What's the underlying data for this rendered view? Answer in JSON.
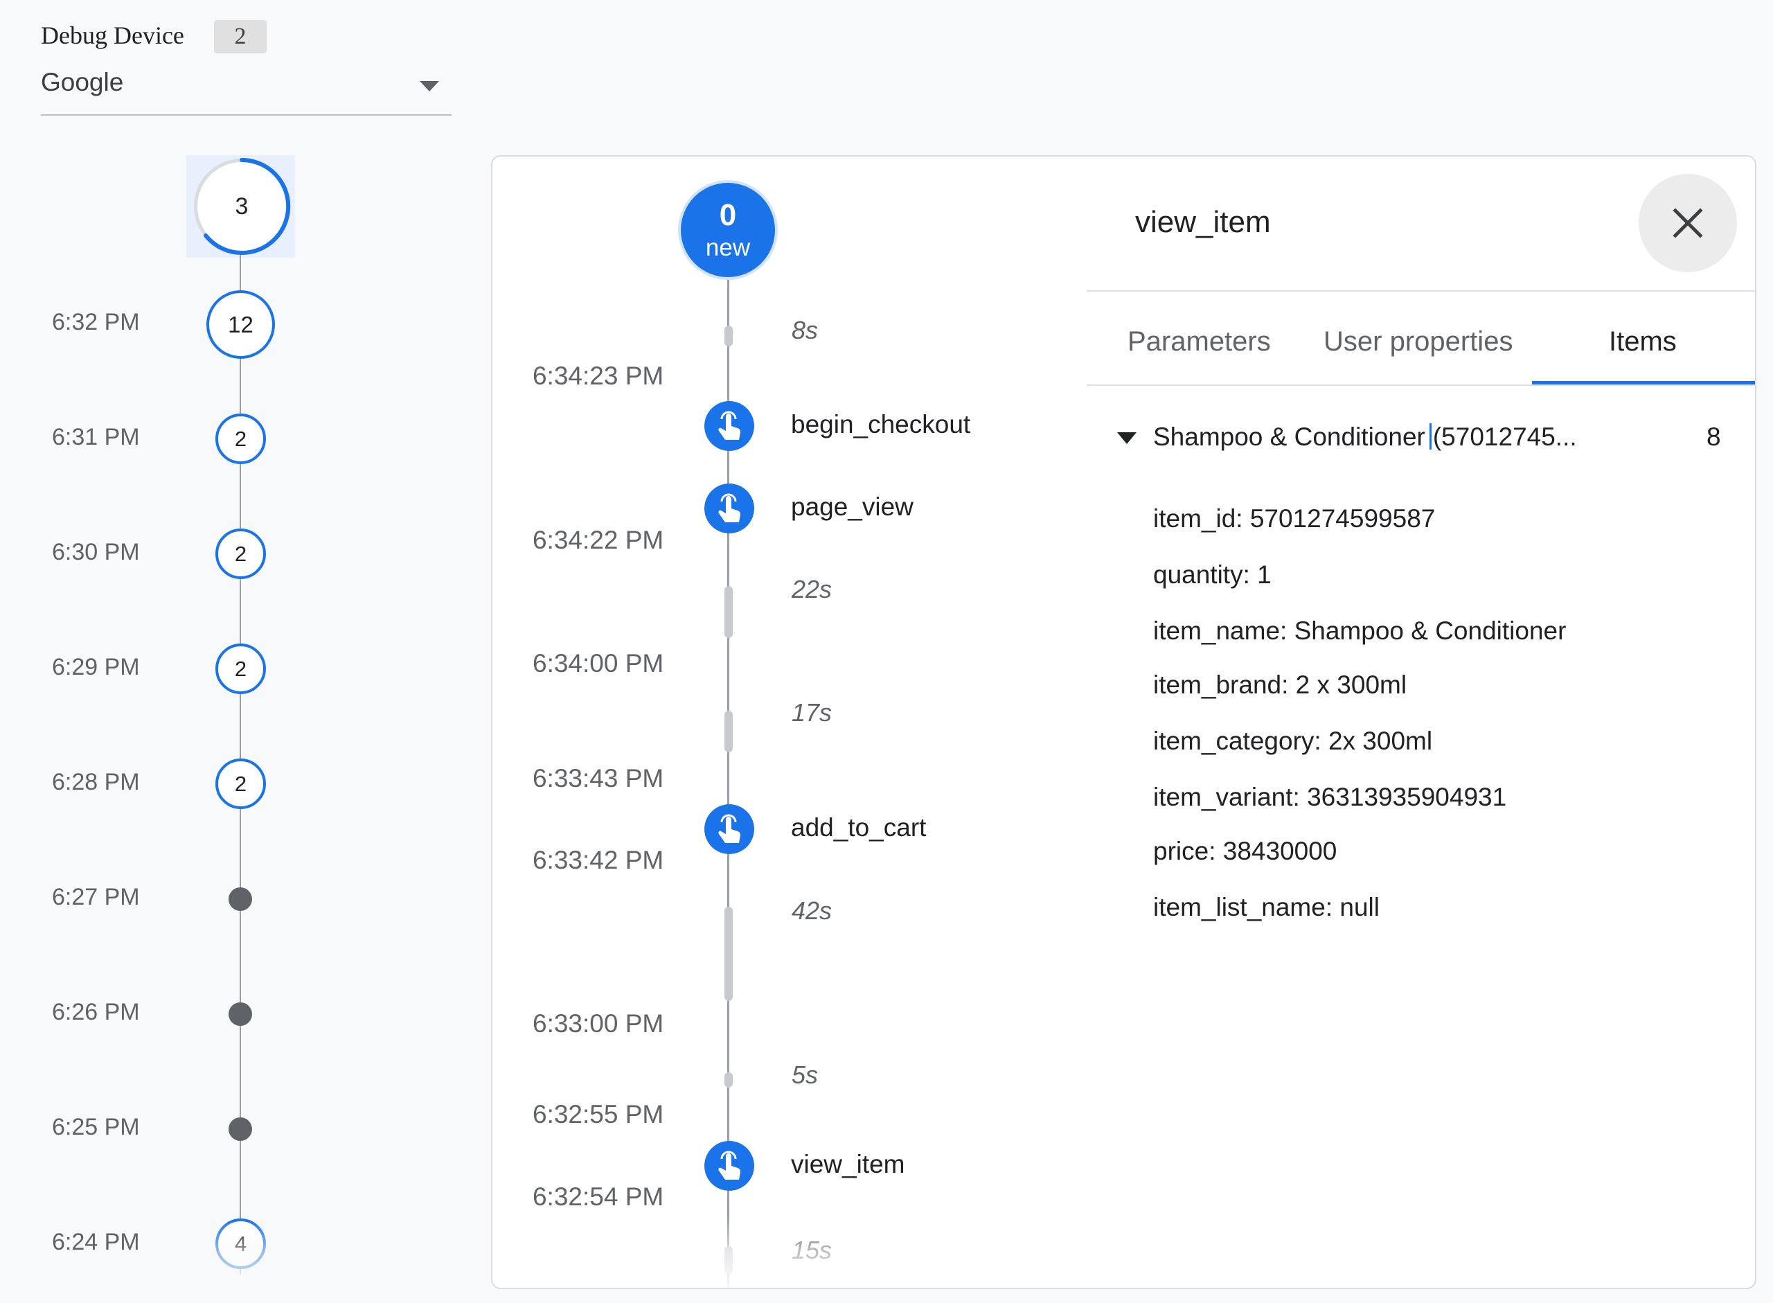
{
  "debug_device": {
    "label": "Debug Device",
    "count": "2",
    "selected": "Google"
  },
  "minutes": {
    "current_count": "3",
    "rows": [
      {
        "time": "6:32 PM",
        "count": "12"
      },
      {
        "time": "6:31 PM",
        "count": "2"
      },
      {
        "time": "6:30 PM",
        "count": "2"
      },
      {
        "time": "6:29 PM",
        "count": "2"
      },
      {
        "time": "6:28 PM",
        "count": "2"
      },
      {
        "time": "6:27 PM",
        "count": null
      },
      {
        "time": "6:26 PM",
        "count": null
      },
      {
        "time": "6:25 PM",
        "count": null
      },
      {
        "time": "6:24 PM",
        "count": "4"
      }
    ]
  },
  "events": {
    "new_count": "0",
    "new_label": "new",
    "gaps": [
      "8s",
      "22s",
      "17s",
      "42s",
      "5s",
      "15s"
    ],
    "times": [
      "6:34:23 PM",
      "6:34:22 PM",
      "6:34:00 PM",
      "6:33:43 PM",
      "6:33:42 PM",
      "6:33:00 PM",
      "6:32:55 PM",
      "6:32:54 PM"
    ],
    "items": [
      {
        "name": "begin_checkout",
        "icon": "touch-icon"
      },
      {
        "name": "page_view",
        "icon": "touch-icon"
      },
      {
        "name": "add_to_cart",
        "icon": "touch-icon"
      },
      {
        "name": "view_item",
        "icon": "touch-icon"
      }
    ]
  },
  "details": {
    "title": "view_item",
    "tabs": [
      "Parameters",
      "User properties",
      "Items"
    ],
    "active_tab": "Items",
    "item": {
      "header_name": "Shampoo & Conditioner",
      "header_suffix": "(57012745...",
      "count": "8",
      "params": [
        "item_id: 5701274599587",
        "quantity: 1",
        "item_name: Shampoo & Conditioner",
        "item_brand: 2 x 300ml",
        "item_category: 2x 300ml",
        "item_variant: 36313935904931",
        "price: 38430000",
        "item_list_name: null"
      ]
    }
  },
  "colors": {
    "accent": "#1a73e8",
    "dot": "#5f6368",
    "timeline": "#9aa0a6"
  }
}
